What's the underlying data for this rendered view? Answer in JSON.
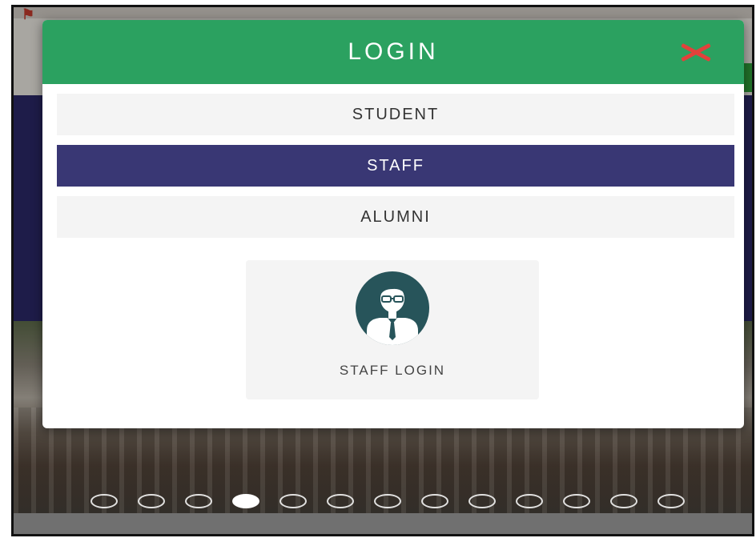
{
  "modal": {
    "title": "LOGIN",
    "close_icon": "close-x-icon",
    "tabs": [
      {
        "label": "STUDENT",
        "active": false
      },
      {
        "label": "STAFF",
        "active": true
      },
      {
        "label": "ALUMNI",
        "active": false
      }
    ],
    "login_card": {
      "icon": "staff-user-icon",
      "label": "STAFF LOGIN"
    }
  },
  "carousel": {
    "slide_count": 13,
    "active_index": 3
  },
  "colors": {
    "header": "#2ba160",
    "active_tab": "#393774",
    "close": "#e2413b",
    "avatar": "#27545a"
  }
}
